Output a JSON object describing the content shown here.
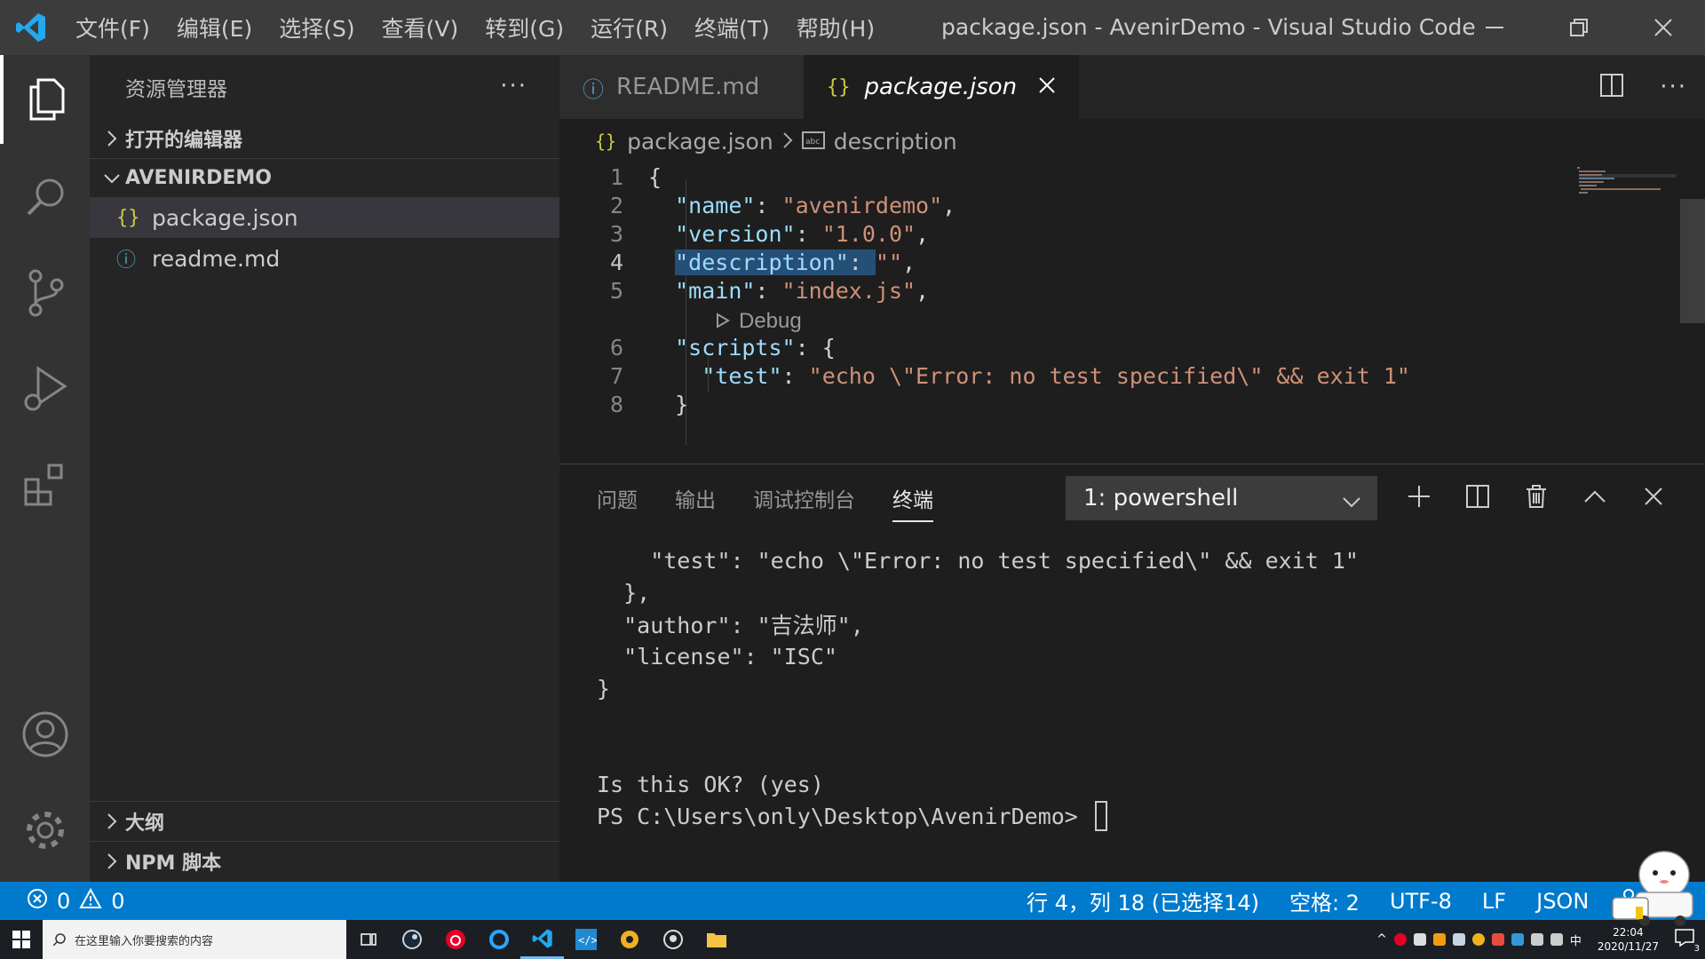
{
  "window": {
    "title": "package.json - AvenirDemo - Visual Studio Code",
    "menus": [
      "文件(F)",
      "编辑(E)",
      "选择(S)",
      "查看(V)",
      "转到(G)",
      "运行(R)",
      "终端(T)",
      "帮助(H)"
    ]
  },
  "activity_bar": {
    "items": [
      "files-icon",
      "search-icon",
      "source-control-icon",
      "run-debug-icon",
      "extensions-icon"
    ],
    "bottom": [
      "account-icon",
      "gear-icon"
    ]
  },
  "sidebar": {
    "title": "资源管理器",
    "more": "···",
    "open_editors": "打开的编辑器",
    "folder": "AVENIRDEMO",
    "files": [
      {
        "name": "package.json",
        "icon": "{}"
      },
      {
        "name": "readme.md",
        "icon": "ⓘ"
      }
    ],
    "outline": "大纲",
    "npm_scripts": "NPM 脚本"
  },
  "tabs": [
    {
      "label": "README.md",
      "icon": "ⓘ"
    },
    {
      "label": "package.json",
      "icon": "{}"
    }
  ],
  "breadcrumb": {
    "file": "package.json",
    "symbol": "description"
  },
  "editor": {
    "codelens": "Debug",
    "lines": [
      {
        "n": "1",
        "text": "{"
      },
      {
        "n": "2",
        "key": "\"name\"",
        "val": "\"avenirdemo\""
      },
      {
        "n": "3",
        "key": "\"version\"",
        "val": "\"1.0.0\""
      },
      {
        "n": "4",
        "key": "\"description\"",
        "val": "\"\""
      },
      {
        "n": "5",
        "key": "\"main\"",
        "val": "\"index.js\""
      },
      {
        "n": "6",
        "key": "\"scripts\"",
        "val": "{"
      },
      {
        "n": "7",
        "key": "\"test\"",
        "val": "\"echo \\\"Error: no test specified\\\" && exit 1\""
      },
      {
        "n": "8",
        "text": "}"
      }
    ]
  },
  "panel": {
    "tabs": [
      "问题",
      "输出",
      "调试控制台",
      "终端"
    ],
    "terminal_select": "1: powershell",
    "terminal_lines": [
      "    \"test\": \"echo \\\"Error: no test specified\\\" && exit 1\"",
      "  },",
      "  \"author\": \"吉法师\",",
      "  \"license\": \"ISC\"",
      "}",
      "",
      "",
      "Is this OK? (yes)",
      "PS C:\\Users\\only\\Desktop\\AvenirDemo> "
    ]
  },
  "status": {
    "errors": "0",
    "warnings": "0",
    "position": "行 4，列 18 (已选择14)",
    "indent": "空格: 2",
    "encoding": "UTF-8",
    "eol": "LF",
    "language": "JSON"
  },
  "taskbar": {
    "search_placeholder": "在这里输入你要搜索的内容",
    "time": "22:04",
    "date": "2020/11/27",
    "ime": "中",
    "notification_count": "3"
  },
  "colors": {
    "accent": "#007acc",
    "string": "#ce9178",
    "key": "#9cdcfe",
    "selection": "#264f78"
  }
}
